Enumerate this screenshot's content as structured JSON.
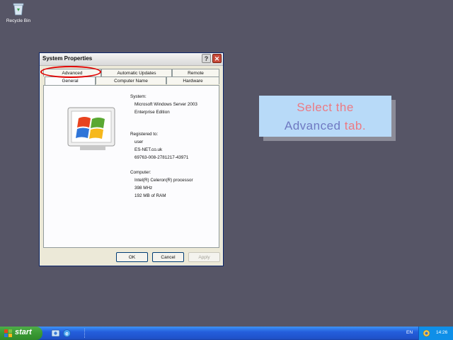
{
  "desktop": {
    "recycle_bin_label": "Recycle Bin"
  },
  "dialog": {
    "title": "System Properties",
    "tabs_back": [
      "Advanced",
      "Automatic Updates",
      "Remote"
    ],
    "tabs_front": [
      "General",
      "Computer Name",
      "Hardware"
    ],
    "active_tab": "General",
    "system_heading": "System:",
    "os_name": "Microsoft Windows Server 2003",
    "os_edition": "Enterprise Edition",
    "registered_heading": "Registered to:",
    "registered_user": "user",
    "registered_org": "ES-NET.co.uk",
    "product_id": "69763-008-2781217-43971",
    "computer_heading": "Computer:",
    "processor": "Intel(R) Celeron(R) processor",
    "speed": "398 MHz",
    "memory": "192 MB of RAM",
    "ok_label": "OK",
    "cancel_label": "Cancel",
    "apply_label": "Apply"
  },
  "callout": {
    "line1": "Select the",
    "word_advanced": "Advanced",
    "word_tab": "tab."
  },
  "taskbar": {
    "start_label": "start",
    "language": "EN",
    "clock": "14:26"
  },
  "colors": {
    "desktop": "#565566",
    "callout_bg": "#b8daf8",
    "callout_red": "#ec7a83",
    "callout_blue": "#6f79c2",
    "highlight": "#e00000"
  }
}
